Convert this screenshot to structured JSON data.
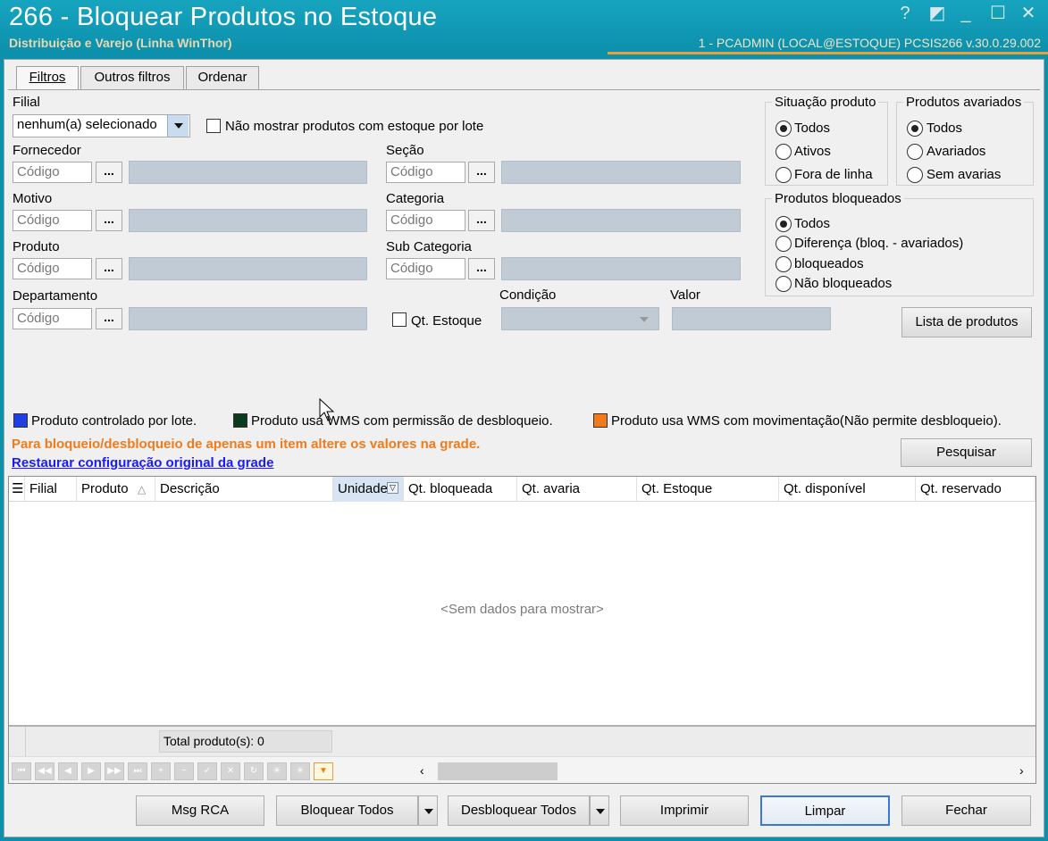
{
  "window": {
    "title": "266 - Bloquear Produtos no Estoque",
    "subtitle": "Distribuição e Varejo (Linha WinThor)",
    "user_info": "1 - PCADMIN (LOCAL@ESTOQUE)   PCSIS266  v.30.0.29.002",
    "controls": {
      "help": "?",
      "restore": "◩",
      "minimize": "_",
      "maximize": "☐",
      "close": "✕"
    }
  },
  "tabs": [
    {
      "label": "Filtros",
      "active": true
    },
    {
      "label": "Outros filtros",
      "active": false
    },
    {
      "label": "Ordenar",
      "active": false
    }
  ],
  "filters": {
    "filial_label": "Filial",
    "filial_value": "nenhum(a) selecionado",
    "no_lote_label": "Não mostrar produtos com estoque por lote",
    "fornecedor_label": "Fornecedor",
    "motivo_label": "Motivo",
    "produto_label": "Produto",
    "departamento_label": "Departamento",
    "secao_label": "Seção",
    "categoria_label": "Categoria",
    "subcategoria_label": "Sub Categoria",
    "codigo_placeholder": "Código",
    "ellipsis": "...",
    "condicao_label": "Condição",
    "valor_label": "Valor",
    "qt_estoque_label": "Qt. Estoque"
  },
  "situacao_produto": {
    "title": "Situação produto",
    "options": [
      "Todos",
      "Ativos",
      "Fora de linha"
    ],
    "selected": "Todos"
  },
  "produtos_avariados": {
    "title": "Produtos avariados",
    "options": [
      "Todos",
      "Avariados",
      "Sem avarias"
    ],
    "selected": "Todos"
  },
  "produtos_bloqueados": {
    "title": "Produtos bloqueados",
    "options": [
      "Todos",
      "Diferença (bloq. - avariados)",
      "bloqueados",
      "Não bloqueados"
    ],
    "selected": "Todos"
  },
  "buttons": {
    "lista_produtos": "Lista de produtos",
    "pesquisar": "Pesquisar",
    "msg_rca": "Msg RCA",
    "bloquear_todos": "Bloquear Todos",
    "desbloquear_todos": "Desbloquear Todos",
    "imprimir": "Imprimir",
    "limpar": "Limpar",
    "fechar": "Fechar"
  },
  "legend": [
    {
      "label": "Produto controlado por lote.",
      "color": "#1f3fe0"
    },
    {
      "label": "Produto usa WMS com permissão de desbloqueio.",
      "color": "#0b3a1e"
    },
    {
      "label": "Produto usa WMS com movimentação(Não permite desbloqueio).",
      "color": "#f07a1c"
    }
  ],
  "warning_text": "Para bloqueio/desbloqueio de apenas um item altere os valores na grade.",
  "warning_color": "#f07a1c",
  "restore_link": "Restaurar configuração original da grade",
  "grid": {
    "columns": [
      "Filial",
      "Produto",
      "Descrição",
      "Unidade",
      "Qt. bloqueada",
      "Qt. avaria",
      "Qt. Estoque",
      "Qt. disponível",
      "Qt. reservado"
    ],
    "sorted_column": "Produto",
    "empty_text": "<Sem dados para mostrar>",
    "total_label": "Total produto(s): 0"
  }
}
